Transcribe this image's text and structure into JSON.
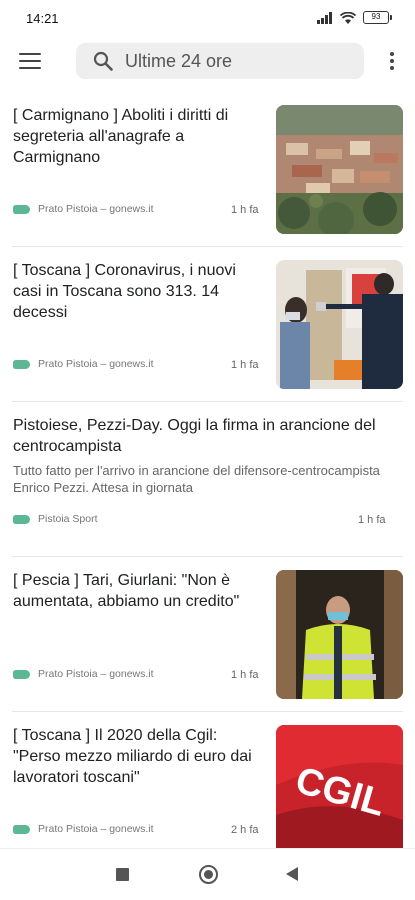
{
  "status": {
    "time": "14:21",
    "battery": "93"
  },
  "search": {
    "text": "Ultime 24 ore"
  },
  "colors": {
    "tag": "#5cb894",
    "search_bg": "#eeeeee"
  },
  "articles": [
    {
      "title": "[ Carmignano ] Aboliti i diritti di segreteria all'anagrafe a Carmignano",
      "source": "Prato Pistoia – gonews.it",
      "time": "1 h fa",
      "image": "town-aerial"
    },
    {
      "title": "[ Toscana ] Coronavirus, i nuovi casi in Toscana sono 313. 14 decessi",
      "source": "Prato Pistoia – gonews.it",
      "time": "1 h fa",
      "image": "temperature-check"
    },
    {
      "title": "Pistoiese, Pezzi-Day. Oggi la firma in arancione del centrocampista",
      "excerpt": "Tutto fatto per l'arrivo in arancione del difensore-centrocampista Enrico Pezzi. Attesa in giornata",
      "source": "Pistoia Sport",
      "time": "1 h fa",
      "image": ""
    },
    {
      "title": "[ Pescia ] Tari, Giurlani: \"Non è aumentata, abbiamo un credito\"",
      "source": "Prato Pistoia – gonews.it",
      "time": "1 h fa",
      "image": "man-yellow-jacket"
    },
    {
      "title": "[ Toscana ] Il 2020 della Cgil: \"Perso mezzo miliardo di euro dai lavoratori toscani\"",
      "source": "Prato Pistoia – gonews.it",
      "time": "2 h fa",
      "image": "cgil-flag",
      "image_text": "CGIL"
    }
  ]
}
